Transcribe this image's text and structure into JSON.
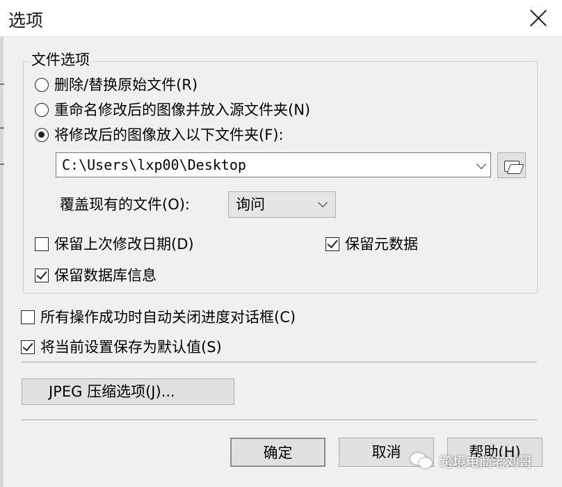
{
  "window": {
    "title": "选项",
    "close_icon": "close-icon"
  },
  "file_options": {
    "legend": "文件选项",
    "radios": [
      {
        "label": "删除/替换原始文件(R)",
        "selected": false
      },
      {
        "label": "重命名修改后的图像并放入源文件夹(N)",
        "selected": false
      },
      {
        "label": "将修改后的图像放入以下文件夹(F):",
        "selected": true
      }
    ],
    "folder_path": "C:\\Users\\lxp00\\Desktop",
    "browse_icon": "folder-browse-icon",
    "overwrite_label": "覆盖现有的文件(O):",
    "overwrite_value": "询问",
    "keep_modified_date": {
      "label": "保留上次修改日期(D)",
      "checked": false
    },
    "keep_metadata": {
      "label": "保留元数据",
      "checked": true
    },
    "keep_database_info": {
      "label": "保留数据库信息",
      "checked": true
    }
  },
  "auto_close": {
    "label": "所有操作成功时自动关闭进度对话框(C)",
    "checked": false
  },
  "save_default": {
    "label": "将当前设置保存为默认值(S)",
    "checked": true
  },
  "jpeg_button": "JPEG 压缩选项(J)...",
  "buttons": {
    "ok": "确定",
    "cancel": "取消",
    "help": "帮助(H)"
  },
  "watermark": {
    "text": "跨境电商老刘哥"
  }
}
